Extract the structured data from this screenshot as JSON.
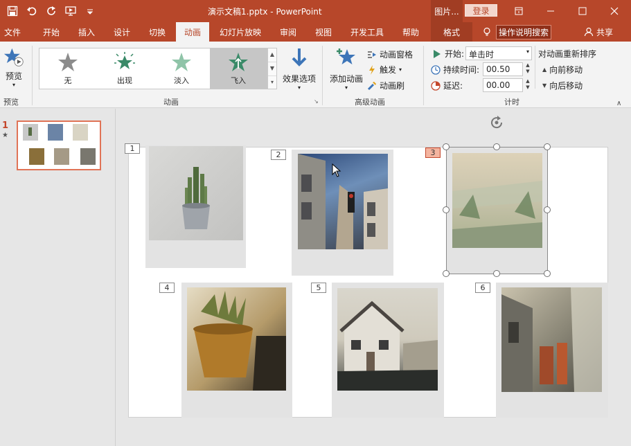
{
  "app": {
    "doc_title": "演示文稿1.pptx  -  PowerPoint",
    "context_label": "图片...",
    "login": "登录"
  },
  "tabs": [
    {
      "label": "文件"
    },
    {
      "label": "开始"
    },
    {
      "label": "插入"
    },
    {
      "label": "设计"
    },
    {
      "label": "切换"
    },
    {
      "label": "动画"
    },
    {
      "label": "幻灯片放映"
    },
    {
      "label": "审阅"
    },
    {
      "label": "视图"
    },
    {
      "label": "开发工具"
    },
    {
      "label": "帮助"
    },
    {
      "label": "格式"
    }
  ],
  "tell_me": "操作说明搜索",
  "share": "共享",
  "ribbon": {
    "preview": {
      "label": "预览",
      "group": "预览"
    },
    "animation_group": "动画",
    "animations": [
      {
        "label": "无"
      },
      {
        "label": "出现"
      },
      {
        "label": "淡入"
      },
      {
        "label": "飞入"
      }
    ],
    "effect_options": "效果选项",
    "add_animation": "添加动画",
    "animation_pane": "动画窗格",
    "trigger": "触发",
    "animation_painter": "动画刷",
    "advanced_group": "高级动画",
    "start_label": "开始:",
    "start_value": "单击时",
    "duration_label": "持续时间:",
    "duration_value": "00.50",
    "delay_label": "延迟:",
    "delay_value": "00.00",
    "timing_group": "计时",
    "reorder_title": "对动画重新排序",
    "move_earlier": "向前移动",
    "move_later": "向后移动"
  },
  "thumb_pane": {
    "slide_number": "1",
    "star": "★"
  },
  "slide": {
    "tags": [
      "1",
      "2",
      "3",
      "4",
      "5",
      "6"
    ]
  },
  "colors": {
    "accent": "#b7472a",
    "selected_tag": "#f4b49f"
  }
}
